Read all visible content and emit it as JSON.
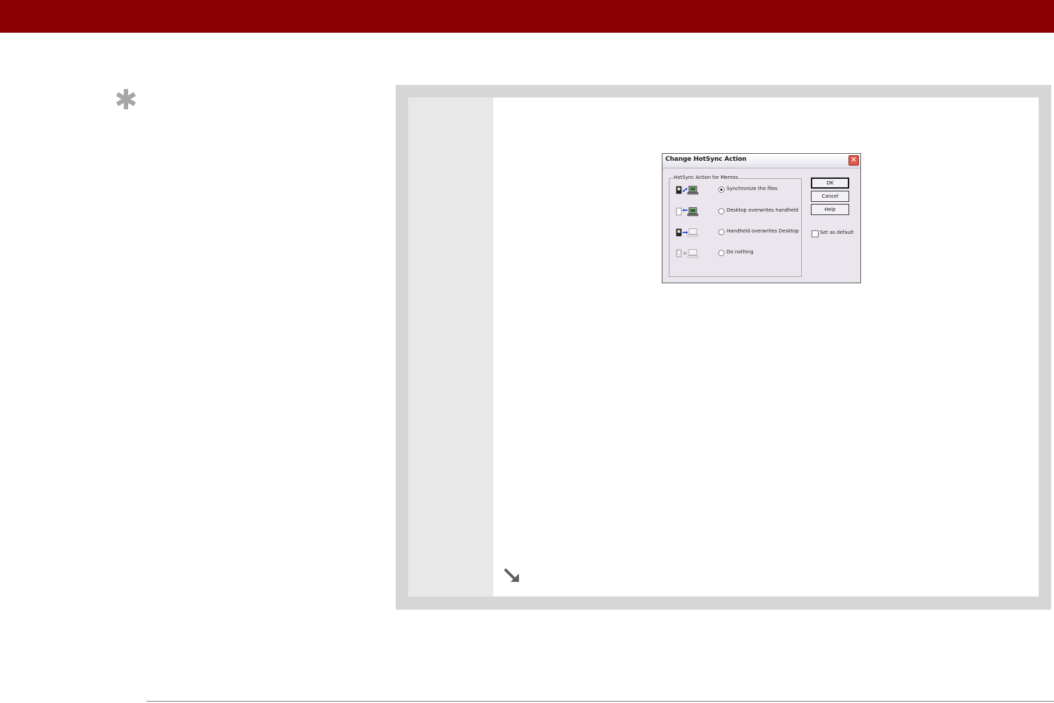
{
  "page": {
    "accent_color": "#8b0000",
    "tip_icon": "asterisk-icon",
    "continue_icon": "continue-arrow-icon"
  },
  "dialog": {
    "title": "Change HotSync Action",
    "close_icon": "close-icon",
    "group_label": "HotSync Action for Memos",
    "options": [
      {
        "label": "Synchronize the files",
        "icon": "sync-both-icon",
        "selected": true
      },
      {
        "label": "Desktop overwrites handheld",
        "icon": "desktop-to-handheld-icon",
        "selected": false
      },
      {
        "label": "Handheld overwrites Desktop",
        "icon": "handheld-to-desktop-icon",
        "selected": false
      },
      {
        "label": "Do nothing",
        "icon": "do-nothing-icon",
        "selected": false
      }
    ],
    "buttons": {
      "ok": "OK",
      "cancel": "Cancel",
      "help": "Help"
    },
    "set_default_label": "Set as default",
    "set_default_checked": false
  }
}
